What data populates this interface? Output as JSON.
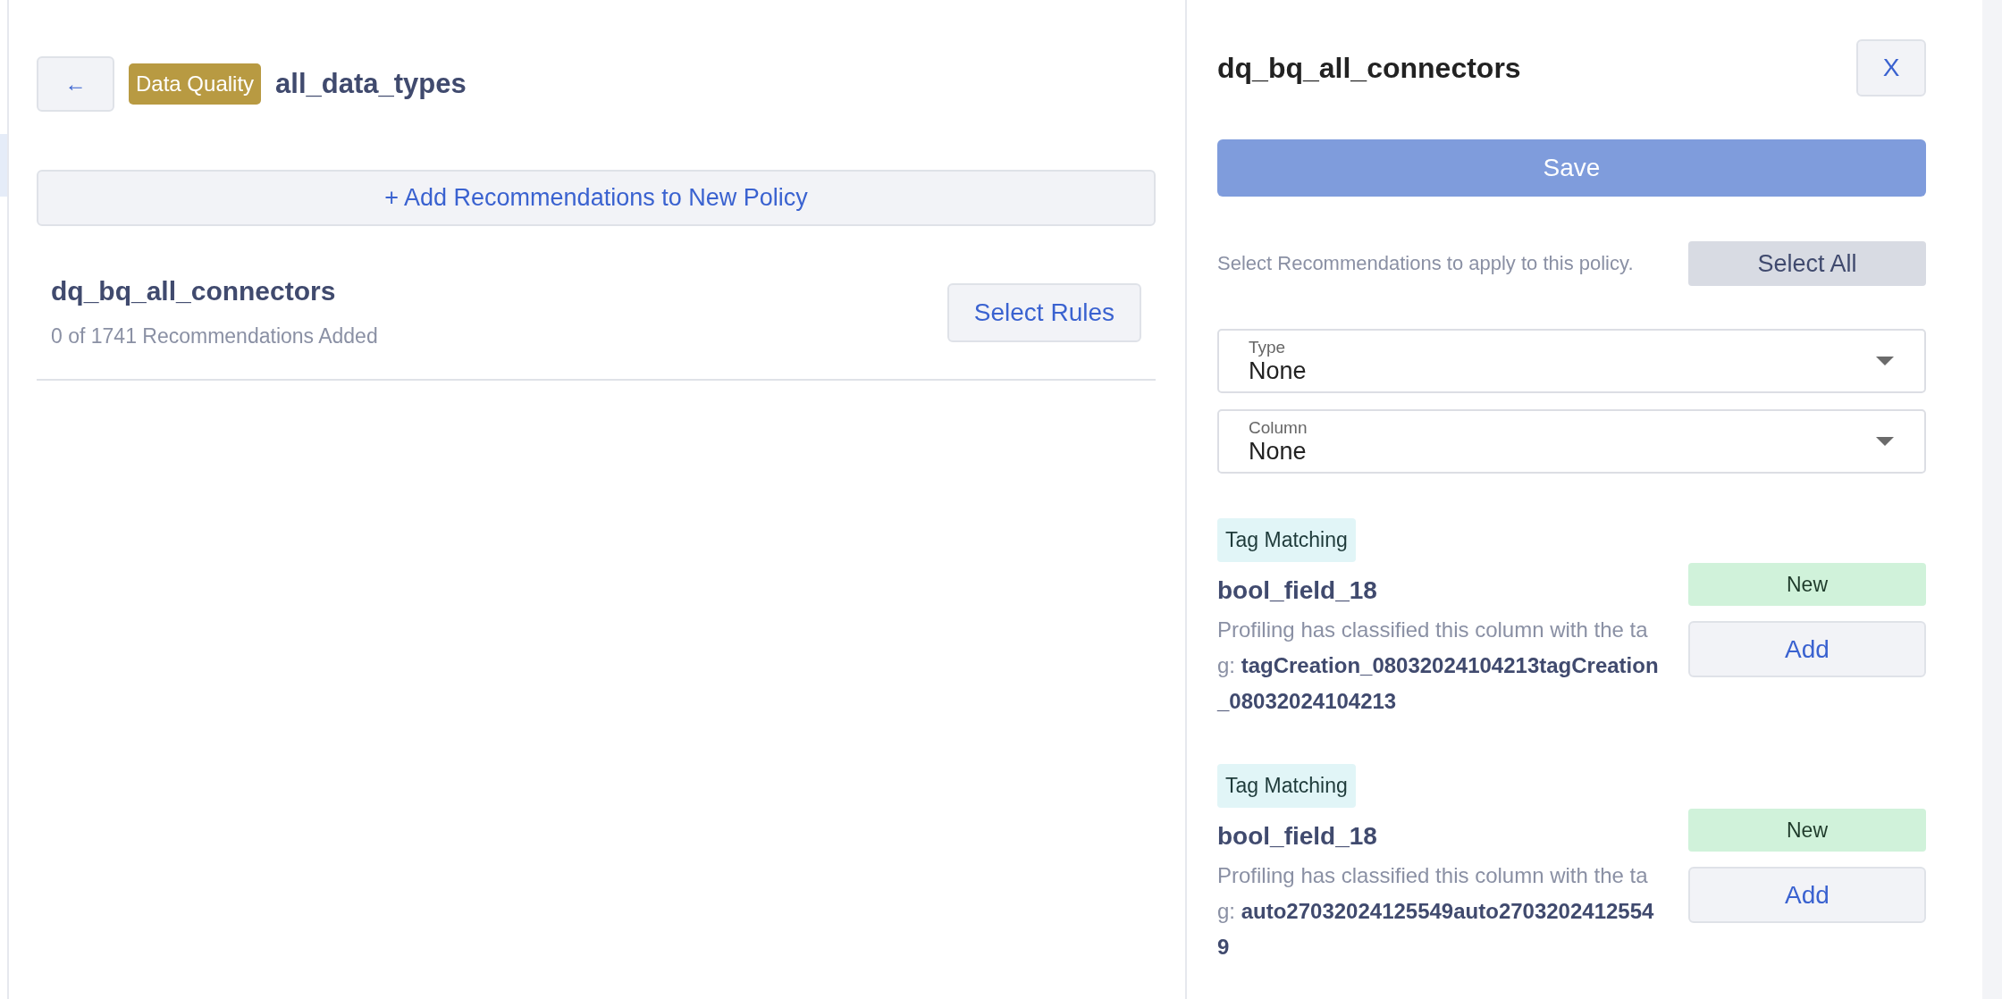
{
  "back_button": {
    "label": "←"
  },
  "header": {
    "badge": "Data Quality",
    "title": "all_data_types"
  },
  "add_policy_button": {
    "label": "+ Add Recommendations to New Policy"
  },
  "policies": [
    {
      "name": "dq_bq_all_connectors",
      "summary": "0 of 1741 Recommendations Added",
      "action": "Select Rules"
    }
  ],
  "panel": {
    "title": "dq_bq_all_connectors",
    "close_button": "X",
    "save_button": {
      "label": "Save",
      "disabled": true
    },
    "instruction": "Select Recommendations to apply to this policy.",
    "select_all_button": "Select All",
    "filters": [
      {
        "label": "Type",
        "value": "None"
      },
      {
        "label": "Column",
        "value": "None"
      }
    ],
    "recommendations": [
      {
        "tag": "Tag Matching",
        "column": "bool_field_18",
        "status": "New",
        "description": "Profiling has classified this column with the tag: **tagCreation_08032024104213tagCreation_08032024104213**",
        "action": "Add"
      },
      {
        "tag": "Tag Matching",
        "column": "bool_field_18",
        "status": "New",
        "description": "Profiling has classified this column with the tag: **auto27032024125549auto27032024125549**",
        "action": "Add"
      }
    ]
  }
}
